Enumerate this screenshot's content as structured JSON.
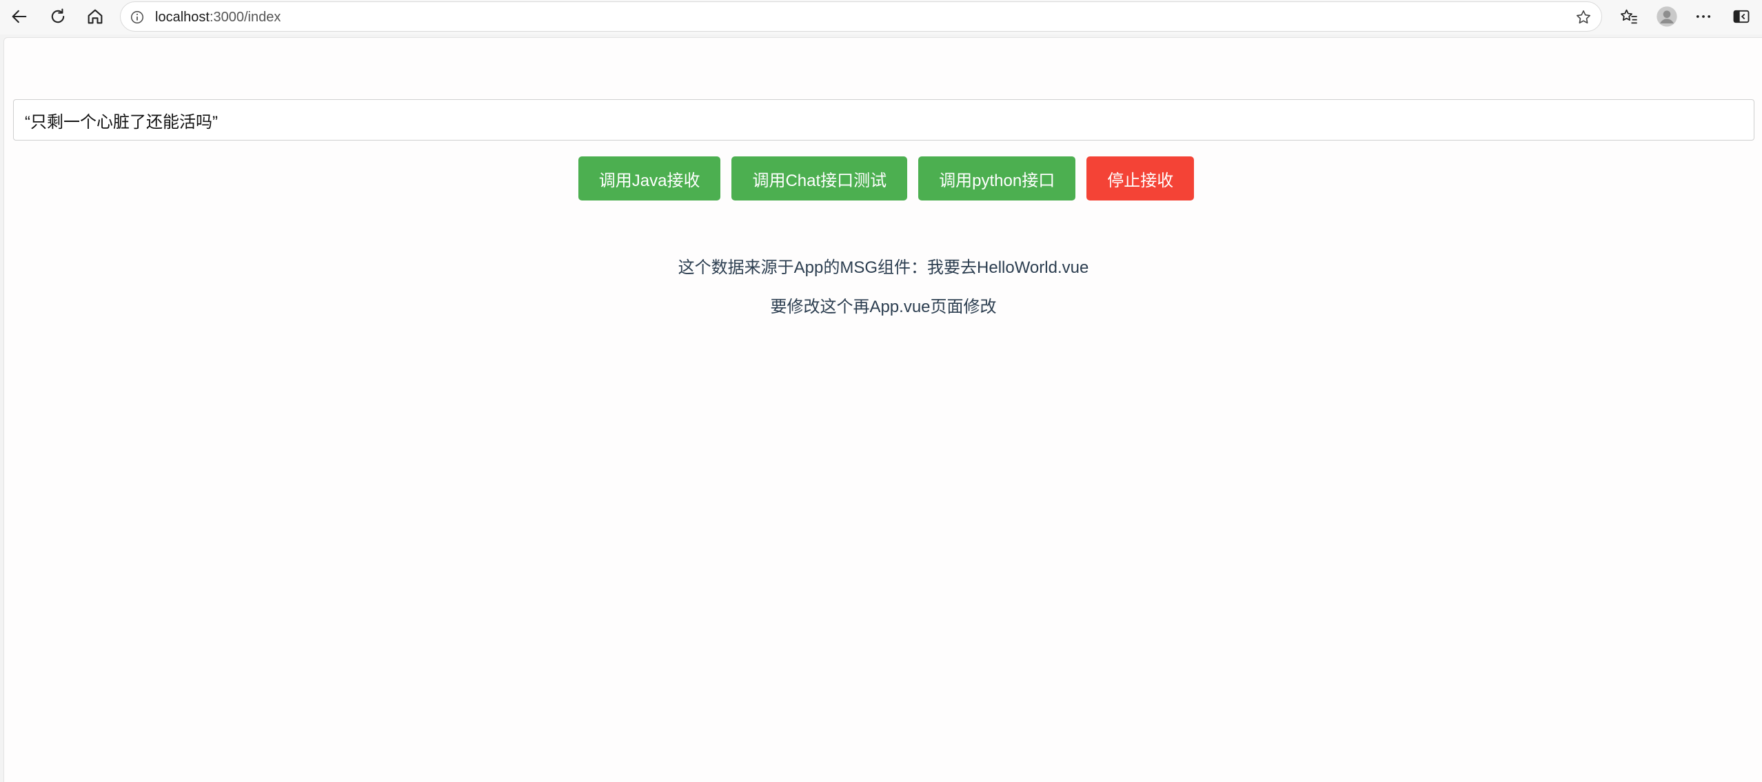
{
  "browser": {
    "url_host": "localhost",
    "url_rest": ":3000/index"
  },
  "prompt": {
    "value": "“只剩一个心脏了还能活吗”"
  },
  "buttons": {
    "java": "调用Java接收",
    "chat": "调用Chat接口测试",
    "python": "调用python接口",
    "stop": "停止接收"
  },
  "messages": {
    "line1": "这个数据来源于App的MSG组件：我要去HelloWorld.vue",
    "line2": "要修改这个再App.vue页面修改"
  },
  "colors": {
    "green": "#4caf50",
    "red": "#f44336",
    "text": "#2c3e50"
  },
  "icons": [
    "back-icon",
    "refresh-icon",
    "home-icon",
    "info-icon",
    "star-icon",
    "favorites-icon",
    "profile-icon",
    "more-icon",
    "sidebar-icon"
  ]
}
